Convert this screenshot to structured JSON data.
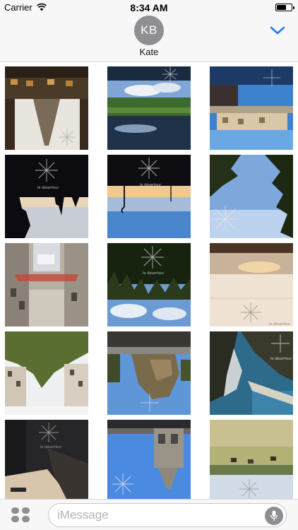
{
  "status_bar": {
    "carrier": "Carrier",
    "time": "8:34 AM",
    "wifi_icon": "wifi-icon",
    "battery_icon": "battery-icon"
  },
  "header": {
    "avatar_initials": "KB",
    "contact_name": "Kate",
    "collapse_icon": "chevron-down-icon",
    "accent_color": "#1a7cf0",
    "avatar_color": "#8e8e93"
  },
  "sticker_watermark": "le déserteur",
  "stickers": [
    {
      "name": "sticker-cathedral-night"
    },
    {
      "name": "sticker-lake-reflection"
    },
    {
      "name": "sticker-harbour-sunset"
    },
    {
      "name": "sticker-silhouette-dusk"
    },
    {
      "name": "sticker-streetlamps-dusk"
    },
    {
      "name": "sticker-pine-sky"
    },
    {
      "name": "sticker-street-buildings"
    },
    {
      "name": "sticker-forest-clouds"
    },
    {
      "name": "sticker-sunset-shore"
    },
    {
      "name": "sticker-tree-facade"
    },
    {
      "name": "sticker-stone-ruins"
    },
    {
      "name": "sticker-sea-cliffs"
    },
    {
      "name": "sticker-dark-street"
    },
    {
      "name": "sticker-church-tower"
    },
    {
      "name": "sticker-field-horses"
    }
  ],
  "bottom_bar": {
    "apps_icon": "app-drawer-icon",
    "input_placeholder": "iMessage",
    "mic_icon": "microphone-icon"
  }
}
